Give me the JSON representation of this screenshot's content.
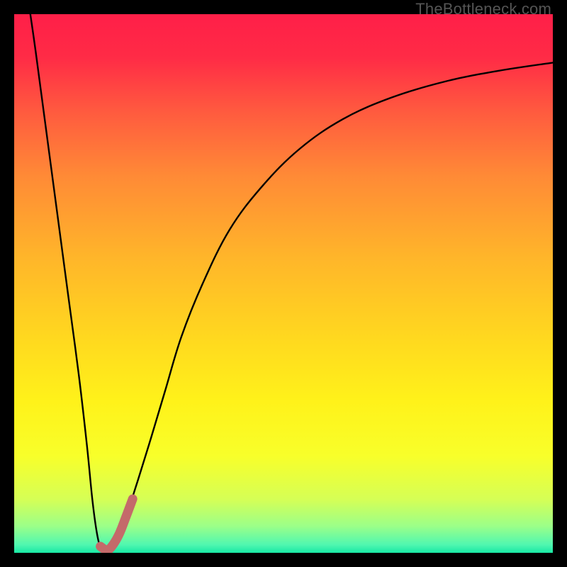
{
  "watermark": "TheBottleneck.com",
  "chart_data": {
    "type": "line",
    "title": "",
    "xlabel": "",
    "ylabel": "",
    "xlim": [
      0,
      100
    ],
    "ylim": [
      0,
      100
    ],
    "grid": false,
    "legend": false,
    "background_gradient": {
      "stops": [
        {
          "offset": 0.0,
          "color": "#ff1f48"
        },
        {
          "offset": 0.08,
          "color": "#ff2b46"
        },
        {
          "offset": 0.18,
          "color": "#ff5a3f"
        },
        {
          "offset": 0.3,
          "color": "#ff8a36"
        },
        {
          "offset": 0.45,
          "color": "#ffb52a"
        },
        {
          "offset": 0.6,
          "color": "#ffd81f"
        },
        {
          "offset": 0.72,
          "color": "#fff21a"
        },
        {
          "offset": 0.82,
          "color": "#f8ff2a"
        },
        {
          "offset": 0.9,
          "color": "#d6ff55"
        },
        {
          "offset": 0.95,
          "color": "#9cff88"
        },
        {
          "offset": 0.985,
          "color": "#50f7b0"
        },
        {
          "offset": 1.0,
          "color": "#18e8a4"
        }
      ]
    },
    "series": [
      {
        "name": "bottleneck-curve",
        "stroke": "#000000",
        "stroke_width": 2.4,
        "data": [
          {
            "x": 3.0,
            "y": 100.0
          },
          {
            "x": 4.0,
            "y": 93.0
          },
          {
            "x": 6.0,
            "y": 78.0
          },
          {
            "x": 8.0,
            "y": 63.0
          },
          {
            "x": 10.0,
            "y": 48.0
          },
          {
            "x": 12.0,
            "y": 33.0
          },
          {
            "x": 13.5,
            "y": 20.0
          },
          {
            "x": 14.5,
            "y": 10.0
          },
          {
            "x": 15.3,
            "y": 4.0
          },
          {
            "x": 16.0,
            "y": 1.0
          },
          {
            "x": 16.8,
            "y": 0.3
          },
          {
            "x": 17.8,
            "y": 0.5
          },
          {
            "x": 19.0,
            "y": 2.5
          },
          {
            "x": 20.5,
            "y": 6.0
          },
          {
            "x": 22.5,
            "y": 12.0
          },
          {
            "x": 25.0,
            "y": 20.0
          },
          {
            "x": 28.0,
            "y": 30.0
          },
          {
            "x": 31.0,
            "y": 40.0
          },
          {
            "x": 35.0,
            "y": 50.0
          },
          {
            "x": 40.0,
            "y": 60.0
          },
          {
            "x": 46.0,
            "y": 68.0
          },
          {
            "x": 53.0,
            "y": 75.0
          },
          {
            "x": 61.0,
            "y": 80.5
          },
          {
            "x": 70.0,
            "y": 84.5
          },
          {
            "x": 80.0,
            "y": 87.5
          },
          {
            "x": 90.0,
            "y": 89.5
          },
          {
            "x": 100.0,
            "y": 91.0
          }
        ]
      },
      {
        "name": "highlight-hook",
        "stroke": "#c46a6a",
        "stroke_width": 13,
        "data": [
          {
            "x": 16.0,
            "y": 1.2
          },
          {
            "x": 17.2,
            "y": 0.5
          },
          {
            "x": 18.2,
            "y": 1.3
          },
          {
            "x": 19.5,
            "y": 3.5
          },
          {
            "x": 20.8,
            "y": 6.8
          },
          {
            "x": 22.0,
            "y": 10.0
          }
        ]
      }
    ]
  }
}
